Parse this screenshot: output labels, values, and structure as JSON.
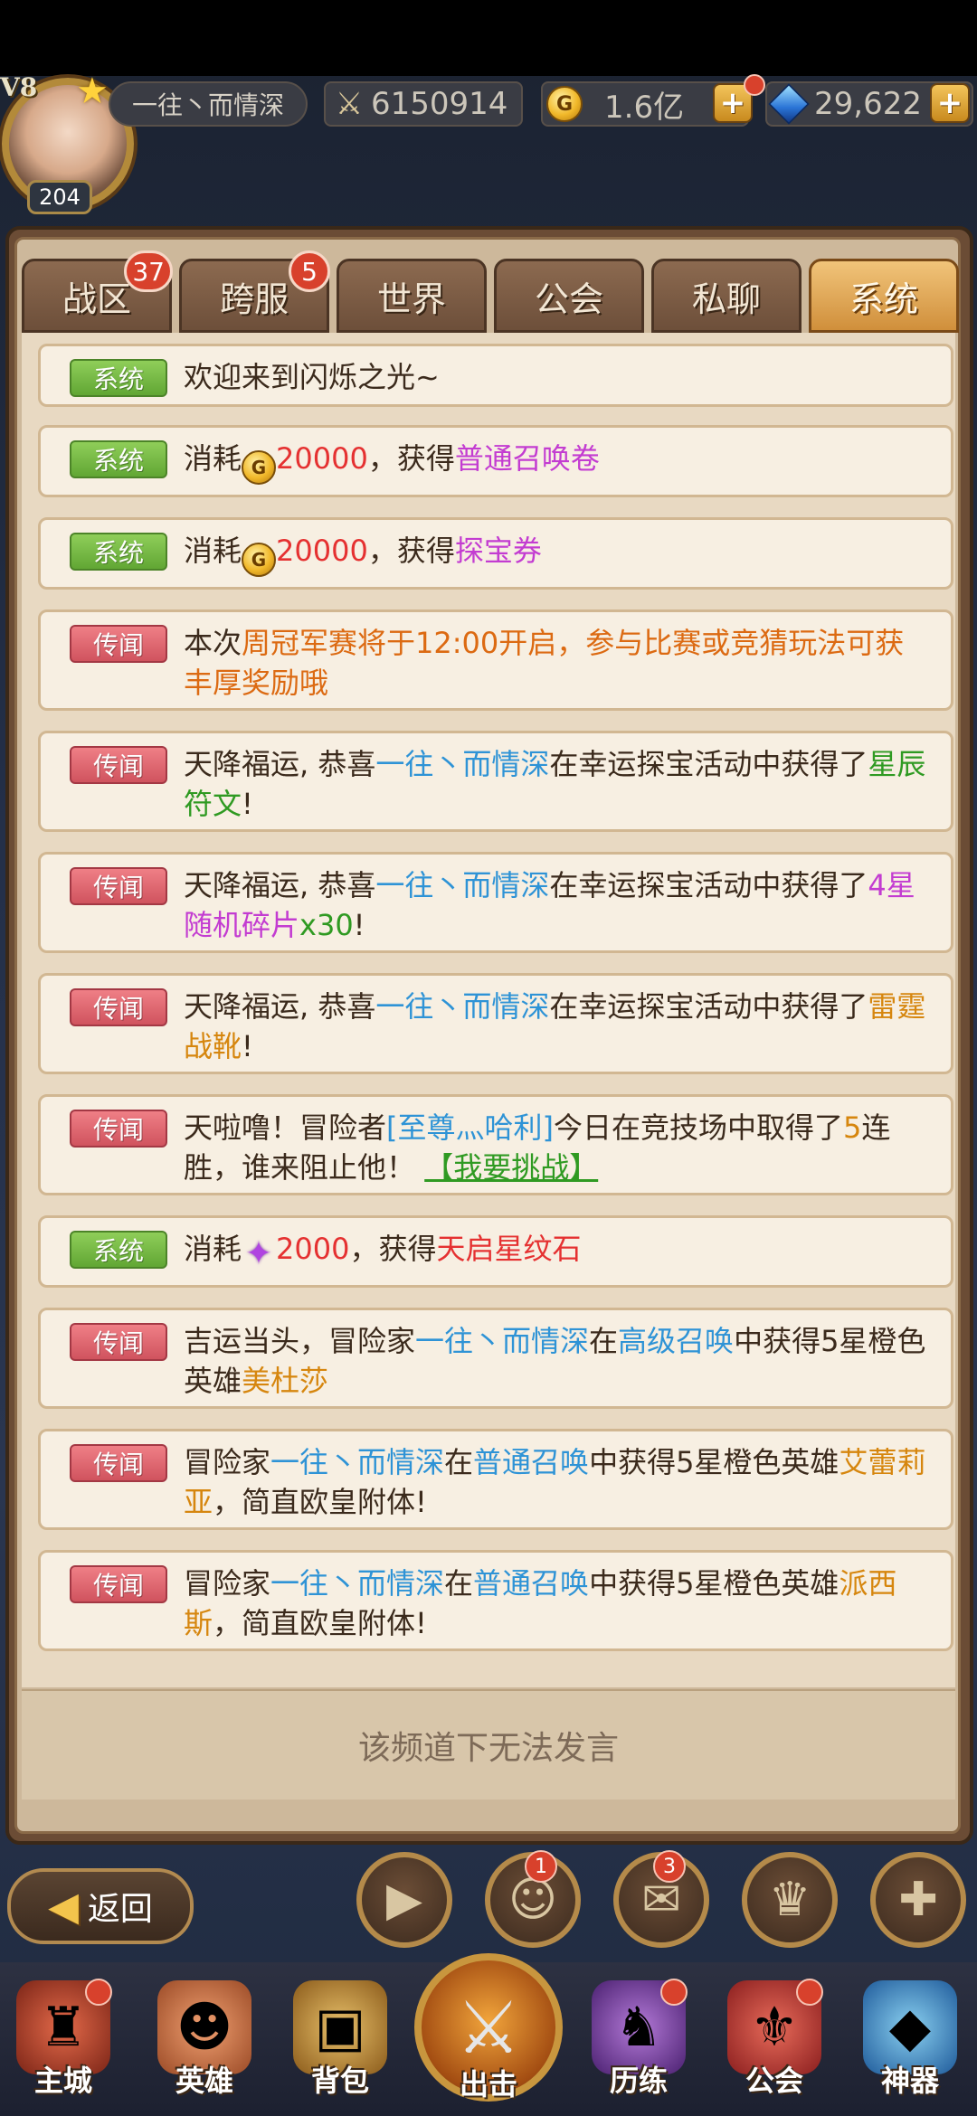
{
  "player": {
    "vip": "V8",
    "level": "204",
    "name": "一往丶而情深",
    "power": "6150914",
    "gold": "1.6亿",
    "gems": "29,622"
  },
  "tabs": [
    {
      "label": "战区",
      "badge": "37"
    },
    {
      "label": "跨服",
      "badge": "5"
    },
    {
      "label": "世界",
      "badge": ""
    },
    {
      "label": "公会",
      "badge": ""
    },
    {
      "label": "私聊",
      "badge": ""
    },
    {
      "label": "系统",
      "badge": "",
      "active": true
    }
  ],
  "tags": {
    "system": "系统",
    "news": "传闻"
  },
  "messages": {
    "m1": {
      "text": "欢迎来到闪烁之光~"
    },
    "m2": {
      "pre": "消耗",
      "amount": "20000",
      "mid": "，获得",
      "item": "普通召唤卷"
    },
    "m3": {
      "pre": "消耗",
      "amount": "20000",
      "mid": "，获得",
      "item": "探宝券"
    },
    "m4": {
      "pre": "本次",
      "event": "周冠军赛将于12:00开启，参与比赛或竞猜玩法可获丰厚奖励哦"
    },
    "m5": {
      "pre": "天降福运, 恭喜",
      "player": "一往丶而情深",
      "mid": "在幸运探宝活动中获得了",
      "item": "星辰符文",
      "end": "!"
    },
    "m6": {
      "pre": "天降福运, 恭喜",
      "player": "一往丶而情深",
      "mid": "在幸运探宝活动中获得了",
      "item": "4星随机碎片",
      "count": "x30",
      "end": "!"
    },
    "m7": {
      "pre": "天降福运, 恭喜",
      "player": "一往丶而情深",
      "mid": "在幸运探宝活动中获得了",
      "item": "雷霆战靴",
      "end": "!"
    },
    "m8": {
      "pre": "天啦噜！冒险者",
      "player": "[至尊灬哈利]",
      "mid": "今日在竞技场中取得了",
      "streak": "5",
      "post": "连胜，谁来阻止他！",
      "link": "【我要挑战】"
    },
    "m9": {
      "pre": "消耗",
      "amount": "2000",
      "mid": "，获得",
      "item": "天启星纹石"
    },
    "m10": {
      "pre": "吉运当头，冒险家",
      "player": "一往丶而情深",
      "mid": "在",
      "source": "高级召唤",
      "mid2": "中获得5星橙色英雄",
      "hero": "美杜莎"
    },
    "m11": {
      "pre": "冒险家",
      "player": "一往丶而情深",
      "mid": "在",
      "source": "普通召唤",
      "mid2": "中获得5星橙色英雄",
      "hero": "艾蕾莉亚",
      "end": "，简直欧皇附体!"
    },
    "m12": {
      "pre": "冒险家",
      "player": "一往丶而情深",
      "mid": "在",
      "source": "普通召唤",
      "mid2": "中获得5星橙色英雄",
      "hero": "派西斯",
      "end": "，简直欧皇附体!"
    }
  },
  "footer": {
    "notice": "该频道下无法发言"
  },
  "actions": {
    "back": "返回",
    "video_badge": "",
    "friends_badge": "1",
    "mail_badge": "3"
  },
  "nav": {
    "main_city": "主城",
    "heroes": "英雄",
    "bag": "背包",
    "attack": "出击",
    "training": "历练",
    "guild": "公会",
    "artifact": "神器"
  },
  "icons": [
    "sword-icon",
    "coin-icon",
    "gem-icon",
    "plus-icon",
    "back-arrow-icon",
    "video-icon",
    "friends-icon",
    "mail-icon",
    "trophy-icon",
    "add-icon",
    "star-icon"
  ]
}
